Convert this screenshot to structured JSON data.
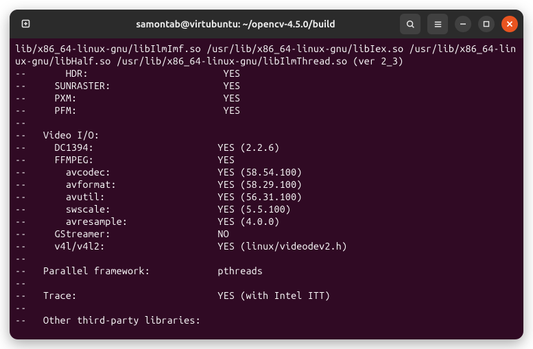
{
  "window": {
    "title": "samontab@virtubuntu: ~/opencv-4.5.0/build"
  },
  "terminal": {
    "wrap": "lib/x86_64-linux-gnu/libIlmImf.so /usr/lib/x86_64-linux-gnu/libIex.so /usr/lib/x86_64-linux-gnu/libHalf.so /usr/lib/x86_64-linux-gnu/libIlmThread.so (ver 2_3)",
    "lines": [
      "--       HDR:                        YES",
      "--     SUNRASTER:                    YES",
      "--     PXM:                          YES",
      "--     PFM:                          YES",
      "-- ",
      "--   Video I/O:",
      "--     DC1394:                      YES (2.2.6)",
      "--     FFMPEG:                      YES",
      "--       avcodec:                   YES (58.54.100)",
      "--       avformat:                  YES (58.29.100)",
      "--       avutil:                    YES (56.31.100)",
      "--       swscale:                   YES (5.5.100)",
      "--       avresample:                YES (4.0.0)",
      "--     GStreamer:                   NO",
      "--     v4l/v4l2:                    YES (linux/videodev2.h)",
      "-- ",
      "--   Parallel framework:            pthreads",
      "-- ",
      "--   Trace:                         YES (with Intel ITT)",
      "-- ",
      "--   Other third-party libraries:"
    ]
  }
}
